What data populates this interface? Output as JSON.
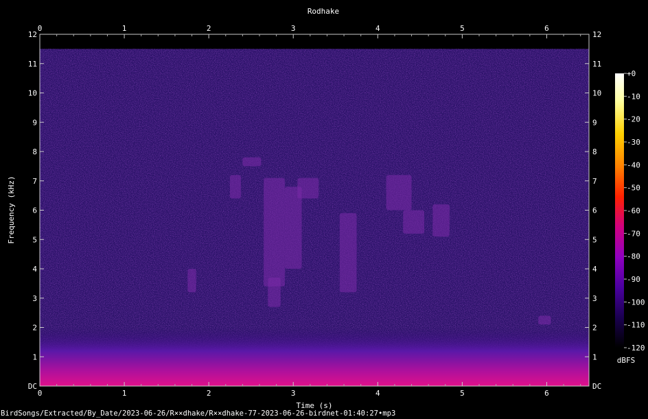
{
  "chart_data": {
    "type": "heatmap",
    "title": "Rodhake",
    "xlabel": "Time (s)",
    "ylabel": "Frequency (kHz)",
    "xlim": [
      0,
      6.5
    ],
    "ylim": [
      0,
      12
    ],
    "x_ticks": [
      "0",
      "1",
      "2",
      "3",
      "4",
      "5",
      "6"
    ],
    "y_ticks": [
      "DC",
      "1",
      "2",
      "3",
      "4",
      "5",
      "6",
      "7",
      "8",
      "9",
      "10",
      "11",
      "12"
    ],
    "colorbar": {
      "label": "dBFS",
      "ticks": [
        "+0",
        "-10",
        "-20",
        "-30",
        "-40",
        "-50",
        "-60",
        "-70",
        "-80",
        "-90",
        "-100",
        "-110",
        "-120"
      ],
      "range": [
        -120,
        0
      ],
      "colormap": [
        "#000000",
        "#1a0050",
        "#4a00a0",
        "#9000c0",
        "#d00080",
        "#ff2000",
        "#ff8000",
        "#ffd000",
        "#ffffa0",
        "#ffffff"
      ]
    },
    "background_level_dbfs": -100,
    "low_frequency_energy": {
      "freq_khz_max": 1.0,
      "level_dbfs": -80
    },
    "energy_ceiling_khz": 11.5,
    "vocalizations": [
      {
        "t_start": 2.25,
        "t_end": 2.38,
        "f_low": 6.4,
        "f_high": 7.2
      },
      {
        "t_start": 2.4,
        "t_end": 2.62,
        "f_low": 7.5,
        "f_high": 7.8
      },
      {
        "t_start": 2.65,
        "t_end": 2.9,
        "f_low": 3.4,
        "f_high": 7.1
      },
      {
        "t_start": 2.9,
        "t_end": 3.1,
        "f_low": 4.0,
        "f_high": 6.8
      },
      {
        "t_start": 2.7,
        "t_end": 2.85,
        "f_low": 2.7,
        "f_high": 3.7
      },
      {
        "t_start": 3.05,
        "t_end": 3.3,
        "f_low": 6.4,
        "f_high": 7.1
      },
      {
        "t_start": 3.55,
        "t_end": 3.75,
        "f_low": 3.2,
        "f_high": 5.9
      },
      {
        "t_start": 4.1,
        "t_end": 4.4,
        "f_low": 6.0,
        "f_high": 7.2
      },
      {
        "t_start": 4.3,
        "t_end": 4.55,
        "f_low": 5.2,
        "f_high": 6.0
      },
      {
        "t_start": 4.65,
        "t_end": 4.85,
        "f_low": 5.1,
        "f_high": 6.2
      },
      {
        "t_start": 1.75,
        "t_end": 1.85,
        "f_low": 3.2,
        "f_high": 4.0
      },
      {
        "t_start": 5.9,
        "t_end": 6.05,
        "f_low": 2.1,
        "f_high": 2.4
      }
    ]
  },
  "filename": "BirdSongs/Extracted/By_Date/2023-06-26/R××dhake/R××dhake-77-2023-06-26-birdnet-01:40:27•mp3"
}
